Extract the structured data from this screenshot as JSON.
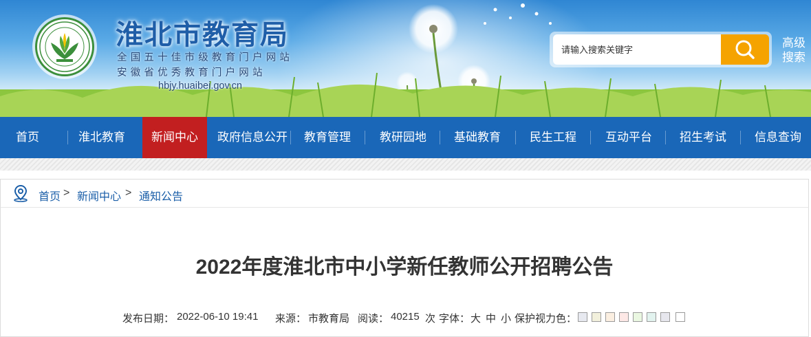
{
  "header": {
    "site_title": "淮北市教育局",
    "subtitle_1": "全国五十佳市级教育门户网站",
    "subtitle_2": "安徽省优秀教育门户网站",
    "url": "hbjy.huaibei.gov.cn",
    "search": {
      "placeholder": "请输入搜索关键字",
      "button_icon": "search-icon",
      "advanced_label_1": "高级",
      "advanced_label_2": "搜索"
    }
  },
  "nav": {
    "items": [
      {
        "label": "首页"
      },
      {
        "label": "淮北教育"
      },
      {
        "label": "新闻中心"
      },
      {
        "label": "政府信息公开"
      },
      {
        "label": "教育管理"
      },
      {
        "label": "教研园地"
      },
      {
        "label": "基础教育"
      },
      {
        "label": "民生工程"
      },
      {
        "label": "互动平台"
      },
      {
        "label": "招生考试"
      },
      {
        "label": "信息查询"
      }
    ],
    "active_index": 2,
    "active_color": "#c21f20",
    "bar_color": "#1a67b8"
  },
  "breadcrumb": {
    "icon": "location-pin-icon",
    "home": "首页",
    "sep": ">",
    "level_1": "新闻中心",
    "level_2": "通知公告"
  },
  "article": {
    "title": "2022年度淮北市中小学新任教师公开招聘公告",
    "meta": {
      "date_label": "发布日期：",
      "date_value": "2022-06-10 19:41",
      "source_label": "来源：",
      "source_value": "市教育局",
      "views_label": "阅读：",
      "views_value": "40215",
      "views_unit": "次",
      "font_label": "字体：",
      "font_large": "大",
      "font_medium": "中",
      "font_small": "小",
      "eye_label": "保护视力色：",
      "eye_colors": [
        "#e7e9f0",
        "#f2f0dc",
        "#fbefe1",
        "#fde8e6",
        "#eaf7e1",
        "#e2f3ef",
        "#e7e7ee",
        "#ffffff"
      ]
    }
  }
}
